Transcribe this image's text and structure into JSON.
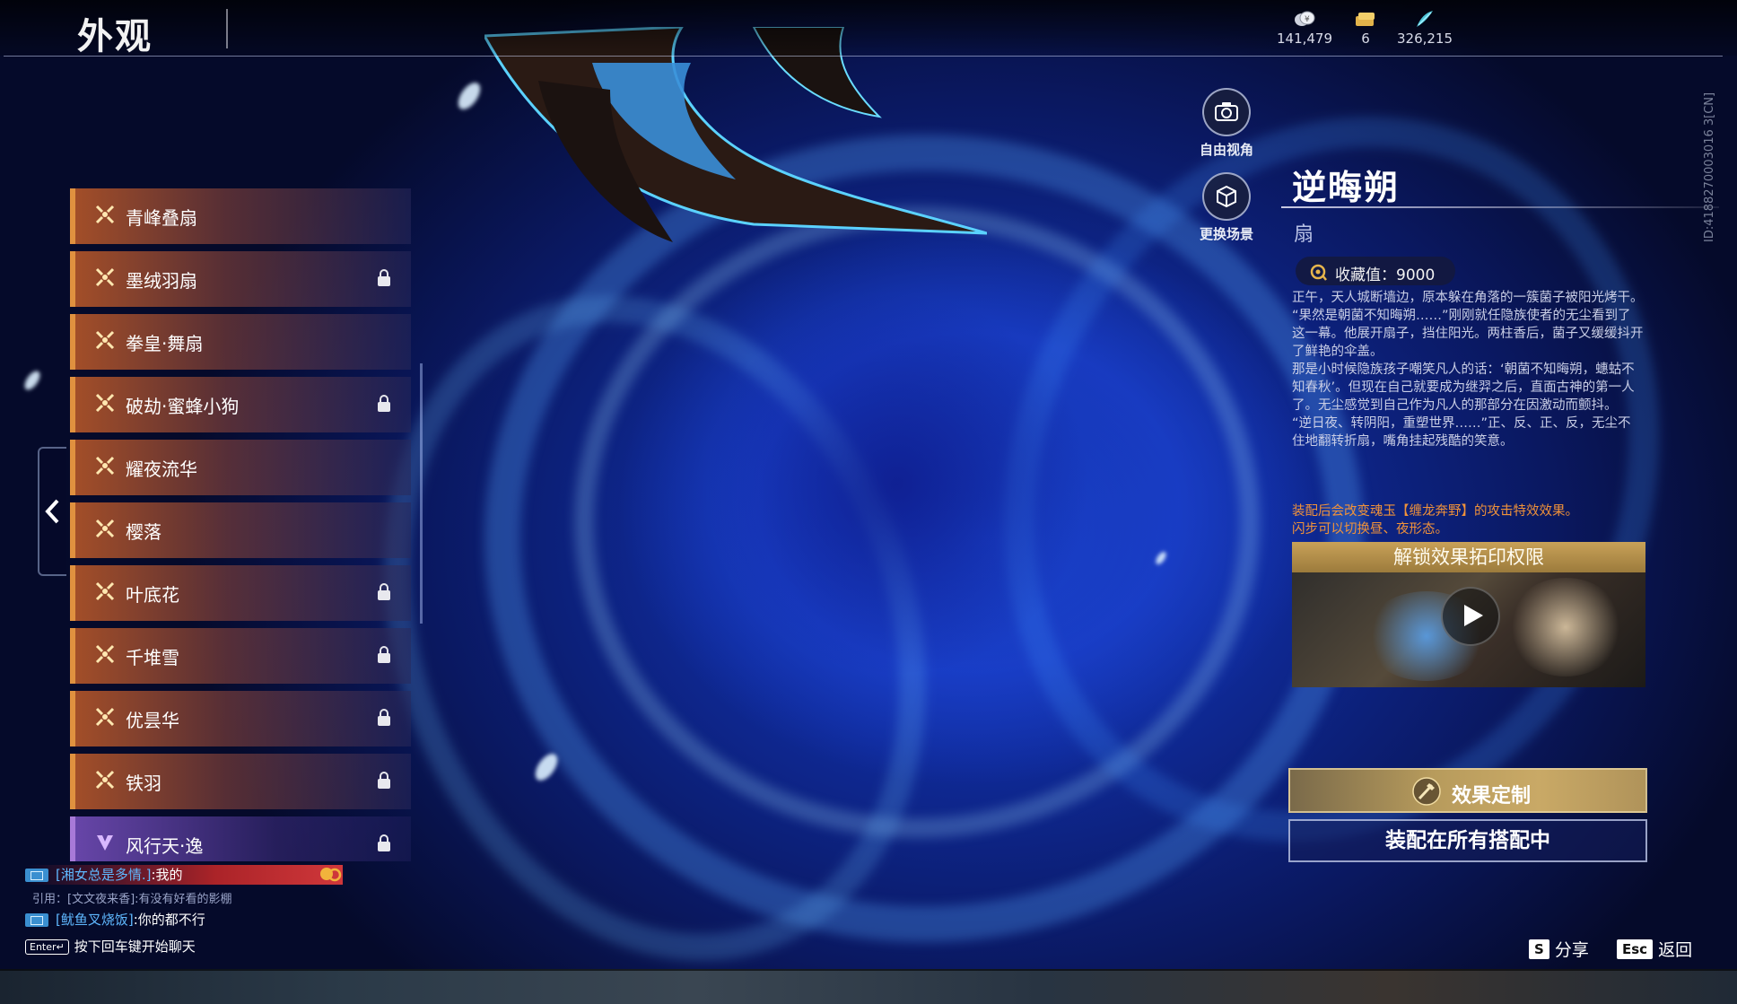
{
  "header": {
    "title": "外观",
    "currencies": [
      {
        "icon": "coin-stack-icon",
        "value": "141,479"
      },
      {
        "icon": "ticket-icon",
        "value": "6"
      },
      {
        "icon": "feather-token-icon",
        "value": "326,215"
      }
    ]
  },
  "camera_controls": {
    "free_view_label": "自由视角",
    "change_scene_label": "更换场景"
  },
  "skins_list": {
    "items": [
      {
        "label": "青峰叠扇",
        "locked": false,
        "rarity": "orange"
      },
      {
        "label": "墨绒羽扇",
        "locked": true,
        "rarity": "orange"
      },
      {
        "label": "拳皇·舞扇",
        "locked": false,
        "rarity": "orange"
      },
      {
        "label": "破劫·蜜蜂小狗",
        "locked": true,
        "rarity": "orange"
      },
      {
        "label": "耀夜流华",
        "locked": false,
        "rarity": "orange"
      },
      {
        "label": "樱落",
        "locked": false,
        "rarity": "orange"
      },
      {
        "label": "叶底花",
        "locked": true,
        "rarity": "orange"
      },
      {
        "label": "千堆雪",
        "locked": true,
        "rarity": "orange"
      },
      {
        "label": "优昙华",
        "locked": true,
        "rarity": "orange"
      },
      {
        "label": "铁羽",
        "locked": true,
        "rarity": "orange"
      },
      {
        "label": "风行天·逸",
        "locked": true,
        "rarity": "purple"
      }
    ]
  },
  "detail": {
    "name": "逆晦朔",
    "type": "扇",
    "collection_value": "收藏值：9000",
    "description": [
      "正午，天人城断墙边，原本躲在角落的一簇菌子被阳光烤干。",
      "“果然是朝菌不知晦朔……”刚刚就任隐族使者的无尘看到了这一幕。他展开扇子，挡住阳光。两柱香后，菌子又缓缓抖开了鲜艳的伞盖。",
      "那是小时候隐族孩子嘲笑凡人的话：‘朝菌不知晦朔，蟪蛄不知春秋’。但现在自己就要成为继羿之后，直面古神的第一人了。无尘感觉到自己作为凡人的那部分在因激动而颤抖。",
      "“逆日夜、转阴阳，重塑世界……”正、反、正、反，无尘不住地翻转折扇，嘴角挂起残酷的笑意。"
    ],
    "effect_note": [
      "装配后会改变魂玉【缠龙奔野】的攻击特效效果。",
      "闪步可以切换昼、夜形态。"
    ],
    "unlock_banner": "解锁效果拓印权限",
    "customize_label": "效果定制",
    "equip_label": "装配在所有搭配中",
    "side_id": "ID:4188270003016 3[CN]"
  },
  "chat": {
    "line1_name": "[湘女总是多情.]",
    "line1_msg": ":我的",
    "quote": "引用：[文文夜来香]:有没有好看的影棚",
    "line2_name": "[鱿鱼叉烧饭]",
    "line2_msg": ":你的都不行",
    "enter_key": "Enter↵",
    "input_hint": "按下回车键开始聊天"
  },
  "hints": {
    "share_key": "S",
    "share_label": "分享",
    "back_key": "Esc",
    "back_label": "返回"
  }
}
